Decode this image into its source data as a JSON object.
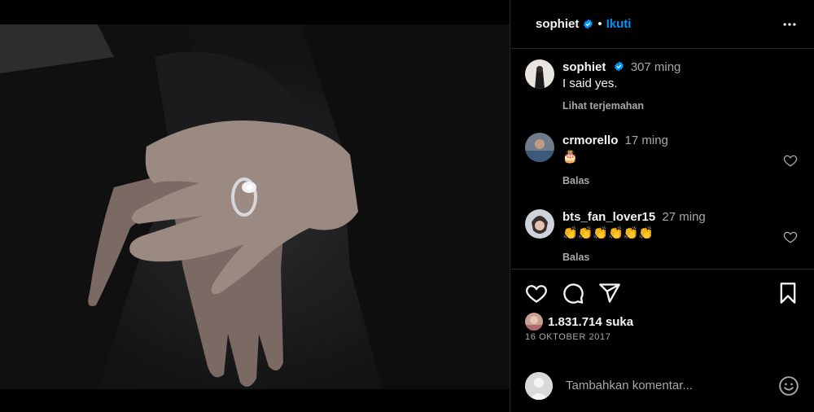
{
  "post": {
    "author": "sophiet",
    "follow_label": "Ikuti",
    "separator": "•",
    "caption": {
      "username": "sophiet",
      "time": "307 ming",
      "text": "I said yes.",
      "translate_label": "Lihat terjemahan"
    },
    "comments": [
      {
        "username": "crmorello",
        "time": "17 ming",
        "text": "🎂",
        "reply_label": "Balas"
      },
      {
        "username": "bts_fan_lover15",
        "time": "27 ming",
        "text": "👏👏👏👏👏👏",
        "reply_label": "Balas"
      }
    ],
    "likes_text": "1.831.714 suka",
    "date": "16 OKTOBER 2017",
    "add_comment_placeholder": "Tambahkan komentar..."
  },
  "colors": {
    "accent": "#0095f6",
    "background": "#000000",
    "secondary_text": "#a8a8a8",
    "divider": "#262626"
  },
  "icons": [
    "verified-badge-icon",
    "more-options-icon",
    "heart-icon",
    "comment-icon",
    "share-icon",
    "bookmark-icon",
    "emoji-icon"
  ]
}
